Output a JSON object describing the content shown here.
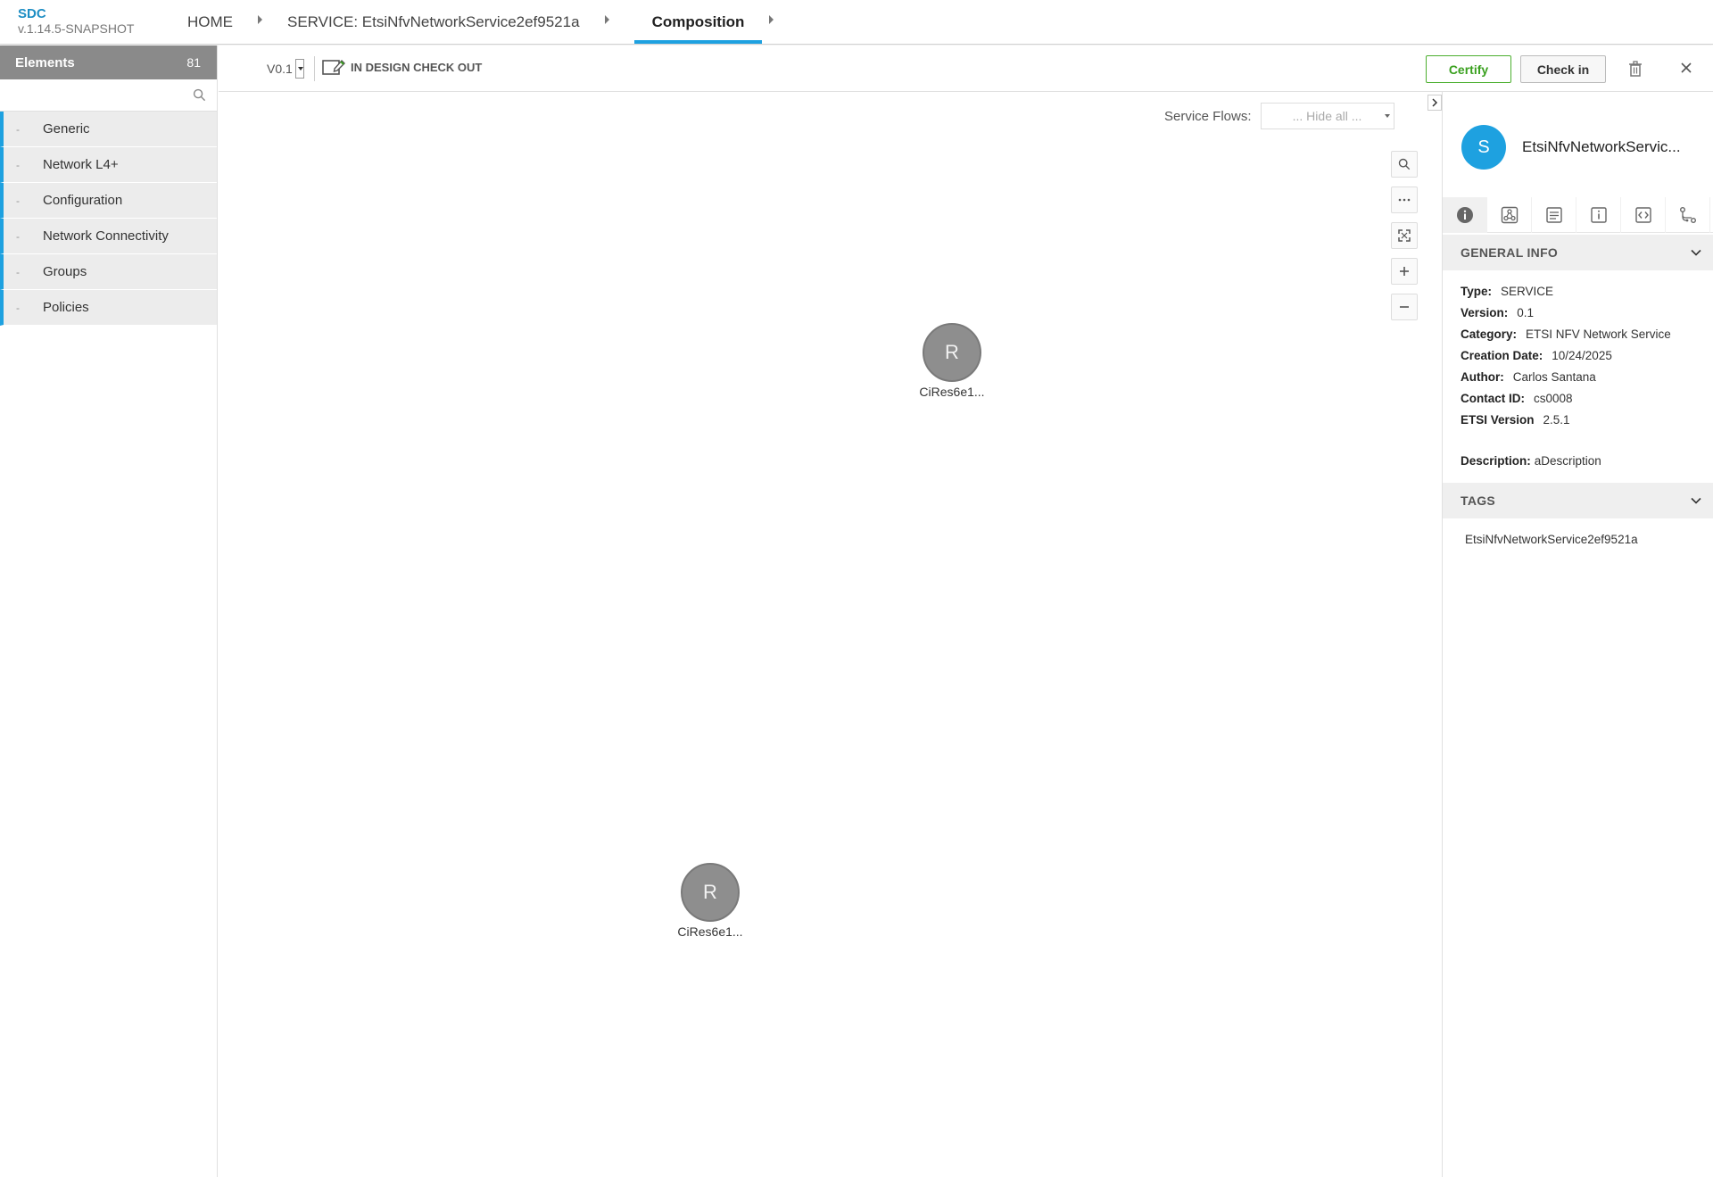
{
  "app": {
    "name": "SDC",
    "version": "v.1.14.5-SNAPSHOT"
  },
  "breadcrumbs": [
    {
      "label": "HOME"
    },
    {
      "label": "SERVICE: EtsiNfvNetworkService2ef9521a"
    },
    {
      "label": "Composition"
    }
  ],
  "palette": {
    "title": "Elements",
    "count": "81",
    "search_placeholder": "",
    "groups": [
      {
        "dash": "-",
        "label": "Generic"
      },
      {
        "dash": "-",
        "label": "Network L4+"
      },
      {
        "dash": "-",
        "label": "Configuration"
      },
      {
        "dash": "-",
        "label": "Network Connectivity"
      },
      {
        "dash": "-",
        "label": "Groups"
      },
      {
        "dash": "-",
        "label": "Policies"
      }
    ]
  },
  "toolbar": {
    "version": "V0.1",
    "status": "IN DESIGN CHECK OUT",
    "certify_label": "Certify",
    "checkin_label": "Check in",
    "accent_green": "#3aa01f"
  },
  "canvas": {
    "service_flows_label": "Service Flows:",
    "service_flows_value": "... Hide all ...",
    "zoom_controls": [
      "search-icon",
      "more-icon",
      "fit-icon",
      "zoom-in-icon",
      "zoom-out-icon"
    ],
    "nodes": [
      {
        "initial": "R",
        "label": "CiRes6e1..."
      },
      {
        "initial": "R",
        "label": "CiRes6e1..."
      }
    ]
  },
  "panel": {
    "avatar_initial": "S",
    "title": "EtsiNfvNetworkServic...",
    "accent_color": "#1ea1e0",
    "tabs": [
      "info-icon",
      "composition-icon",
      "notes-icon",
      "properties-icon",
      "code-icon",
      "paths-icon"
    ],
    "general_info": {
      "title": "GENERAL INFO",
      "rows": [
        {
          "label": "Type:",
          "value": "SERVICE"
        },
        {
          "label": "Version:",
          "value": "0.1"
        },
        {
          "label": "Category:",
          "value": "ETSI NFV Network Service"
        },
        {
          "label": "Creation Date:",
          "value": "10/24/2025"
        },
        {
          "label": "Author:",
          "value": "Carlos Santana"
        },
        {
          "label": "Contact ID:",
          "value": "cs0008"
        },
        {
          "label": "ETSI Version",
          "value": "2.5.1"
        }
      ],
      "description_label": "Description:",
      "description_value": "aDescription"
    },
    "tags": {
      "title": "TAGS",
      "items": [
        "EtsiNfvNetworkService2ef9521a"
      ]
    }
  }
}
